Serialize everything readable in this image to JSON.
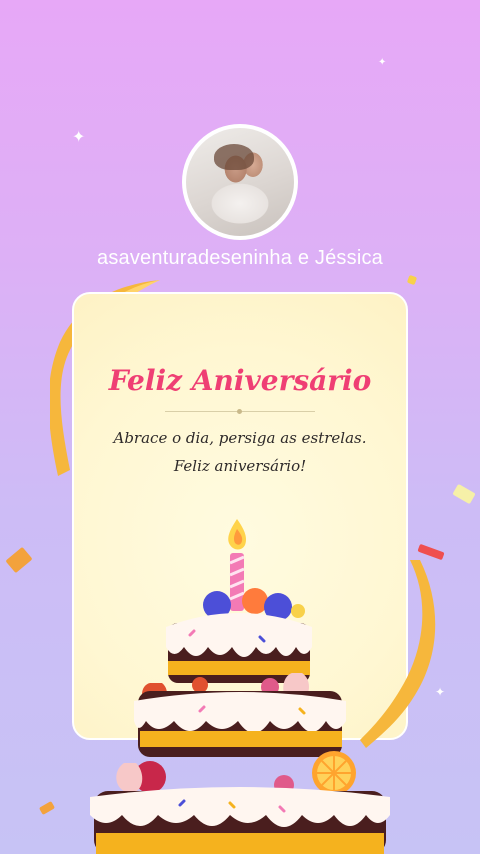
{
  "profile": {
    "username": "asaventuradeseninha e Jéssica"
  },
  "card": {
    "title": "Feliz Aniversário",
    "message": "Abrace o dia, persiga as estrelas. Feliz aniversário!"
  },
  "colors": {
    "background_top": "#e7a8f7",
    "background_bottom": "#c7c3f5",
    "title": "#ef3f74",
    "card": "#fff7d2"
  }
}
